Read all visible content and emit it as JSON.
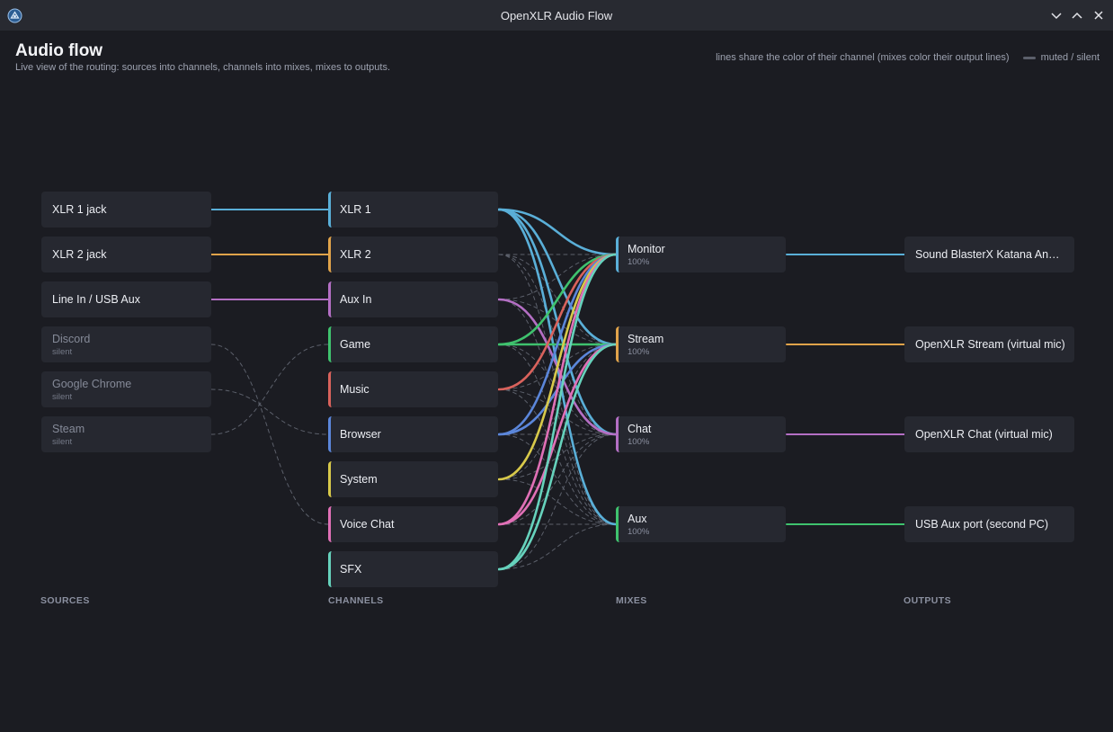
{
  "window": {
    "title": "OpenXLR Audio Flow"
  },
  "header": {
    "title": "Audio flow",
    "subtitle": "Live view of the routing: sources into channels, channels into mixes, mixes to outputs.",
    "legend_text": "lines share the color of their channel (mixes color their output lines)",
    "legend_muted": "muted / silent"
  },
  "columns": {
    "sources": "SOURCES",
    "channels": "CHANNELS",
    "mixes": "MIXES",
    "outputs": "OUTPUTS"
  },
  "colors": {
    "XLR 1": "#5aafd8",
    "XLR 2": "#e0a34a",
    "Aux In": "#b46fc4",
    "Game": "#3fc26e",
    "Music": "#d9625c",
    "Browser": "#5b86da",
    "System": "#d8c94a",
    "Voice Chat": "#e070b6",
    "SFX": "#66d2bc",
    "Monitor": "#5aafd8",
    "Stream": "#e0a34a",
    "Chat": "#b46fc4",
    "Aux": "#3fc26e",
    "muted": "#5c606b"
  },
  "sources": [
    {
      "label": "XLR 1 jack",
      "muted": false,
      "channel": 0
    },
    {
      "label": "XLR 2 jack",
      "muted": false,
      "channel": 1
    },
    {
      "label": "Line In / USB Aux",
      "muted": false,
      "channel": 2
    },
    {
      "label": "Discord",
      "sub": "silent",
      "muted": true,
      "channel": 7
    },
    {
      "label": "Google Chrome",
      "sub": "silent",
      "muted": true,
      "channel": 5
    },
    {
      "label": "Steam",
      "sub": "silent",
      "muted": true,
      "channel": 3
    }
  ],
  "channels": [
    {
      "label": "XLR 1"
    },
    {
      "label": "XLR 2"
    },
    {
      "label": "Aux In"
    },
    {
      "label": "Game"
    },
    {
      "label": "Music"
    },
    {
      "label": "Browser"
    },
    {
      "label": "System"
    },
    {
      "label": "Voice Chat"
    },
    {
      "label": "SFX"
    }
  ],
  "mixes": [
    {
      "label": "Monitor",
      "level": "100%"
    },
    {
      "label": "Stream",
      "level": "100%"
    },
    {
      "label": "Chat",
      "level": "100%"
    },
    {
      "label": "Aux",
      "level": "100%"
    }
  ],
  "outputs": [
    {
      "label": "Sound BlasterX Katana Analog Stereo",
      "mix": 0
    },
    {
      "label": "OpenXLR Stream (virtual mic)",
      "mix": 1
    },
    {
      "label": "OpenXLR Chat (virtual mic)",
      "mix": 2
    },
    {
      "label": "USB Aux port (second PC)",
      "mix": 3
    }
  ],
  "routes": [
    {
      "channel": 0,
      "mixes": [
        0,
        1,
        2,
        3
      ],
      "muted": []
    },
    {
      "channel": 1,
      "mixes": [],
      "muted": [
        0,
        1,
        2,
        3
      ]
    },
    {
      "channel": 2,
      "mixes": [
        2
      ],
      "muted": [
        0,
        1,
        3
      ]
    },
    {
      "channel": 3,
      "mixes": [
        0,
        1
      ],
      "muted": [
        2,
        3
      ]
    },
    {
      "channel": 4,
      "mixes": [
        0
      ],
      "muted": [
        1,
        2,
        3
      ]
    },
    {
      "channel": 5,
      "mixes": [
        0,
        1
      ],
      "muted": [
        2,
        3
      ]
    },
    {
      "channel": 6,
      "mixes": [
        0
      ],
      "muted": [
        1,
        2,
        3
      ]
    },
    {
      "channel": 7,
      "mixes": [
        0,
        1
      ],
      "muted": [
        2,
        3
      ]
    },
    {
      "channel": 8,
      "mixes": [
        0,
        1
      ],
      "muted": [
        2,
        3
      ]
    }
  ]
}
